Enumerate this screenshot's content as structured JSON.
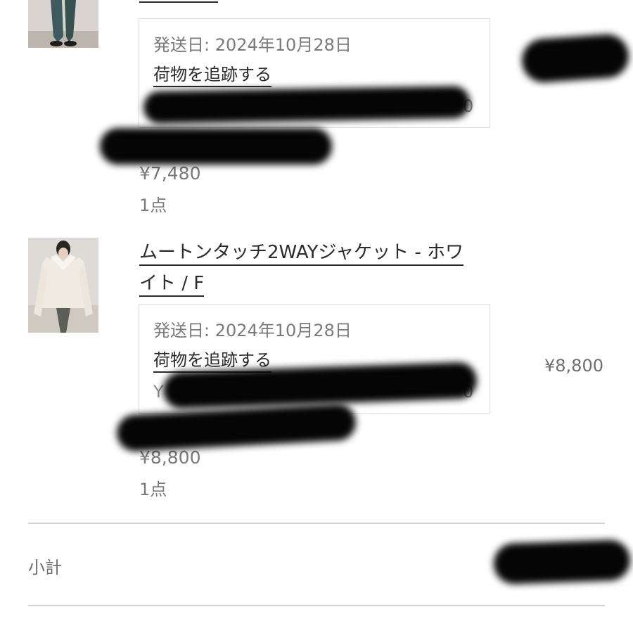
{
  "items": [
    {
      "title_lines": [
        "",
        ""
      ],
      "thumbnail_icon": "product-photo-pants",
      "ship_date": "発送日: 2024年10月28日",
      "track_label": "荷物を追跡する",
      "tracking_head": "",
      "tracking_tail": "0",
      "price": "¥7,480",
      "quantity": "1点",
      "line_price": ""
    },
    {
      "title_lines": [
        "ムートンタッチ2WAYジャケット - ホワ",
        "イト / F"
      ],
      "thumbnail_icon": "product-photo-jacket",
      "ship_date": "発送日: 2024年10月28日",
      "track_label": "荷物を追跡する",
      "tracking_head": "Y",
      "tracking_tail": "0",
      "price": "¥8,800",
      "quantity": "1点",
      "line_price": "¥8,800"
    }
  ],
  "summary": {
    "subtotal_label": "小計"
  },
  "colors": {
    "text_dark": "#2b2b2b",
    "text_muted": "#6e6e6e",
    "border": "#dcdcdc",
    "redaction": "#050505"
  }
}
